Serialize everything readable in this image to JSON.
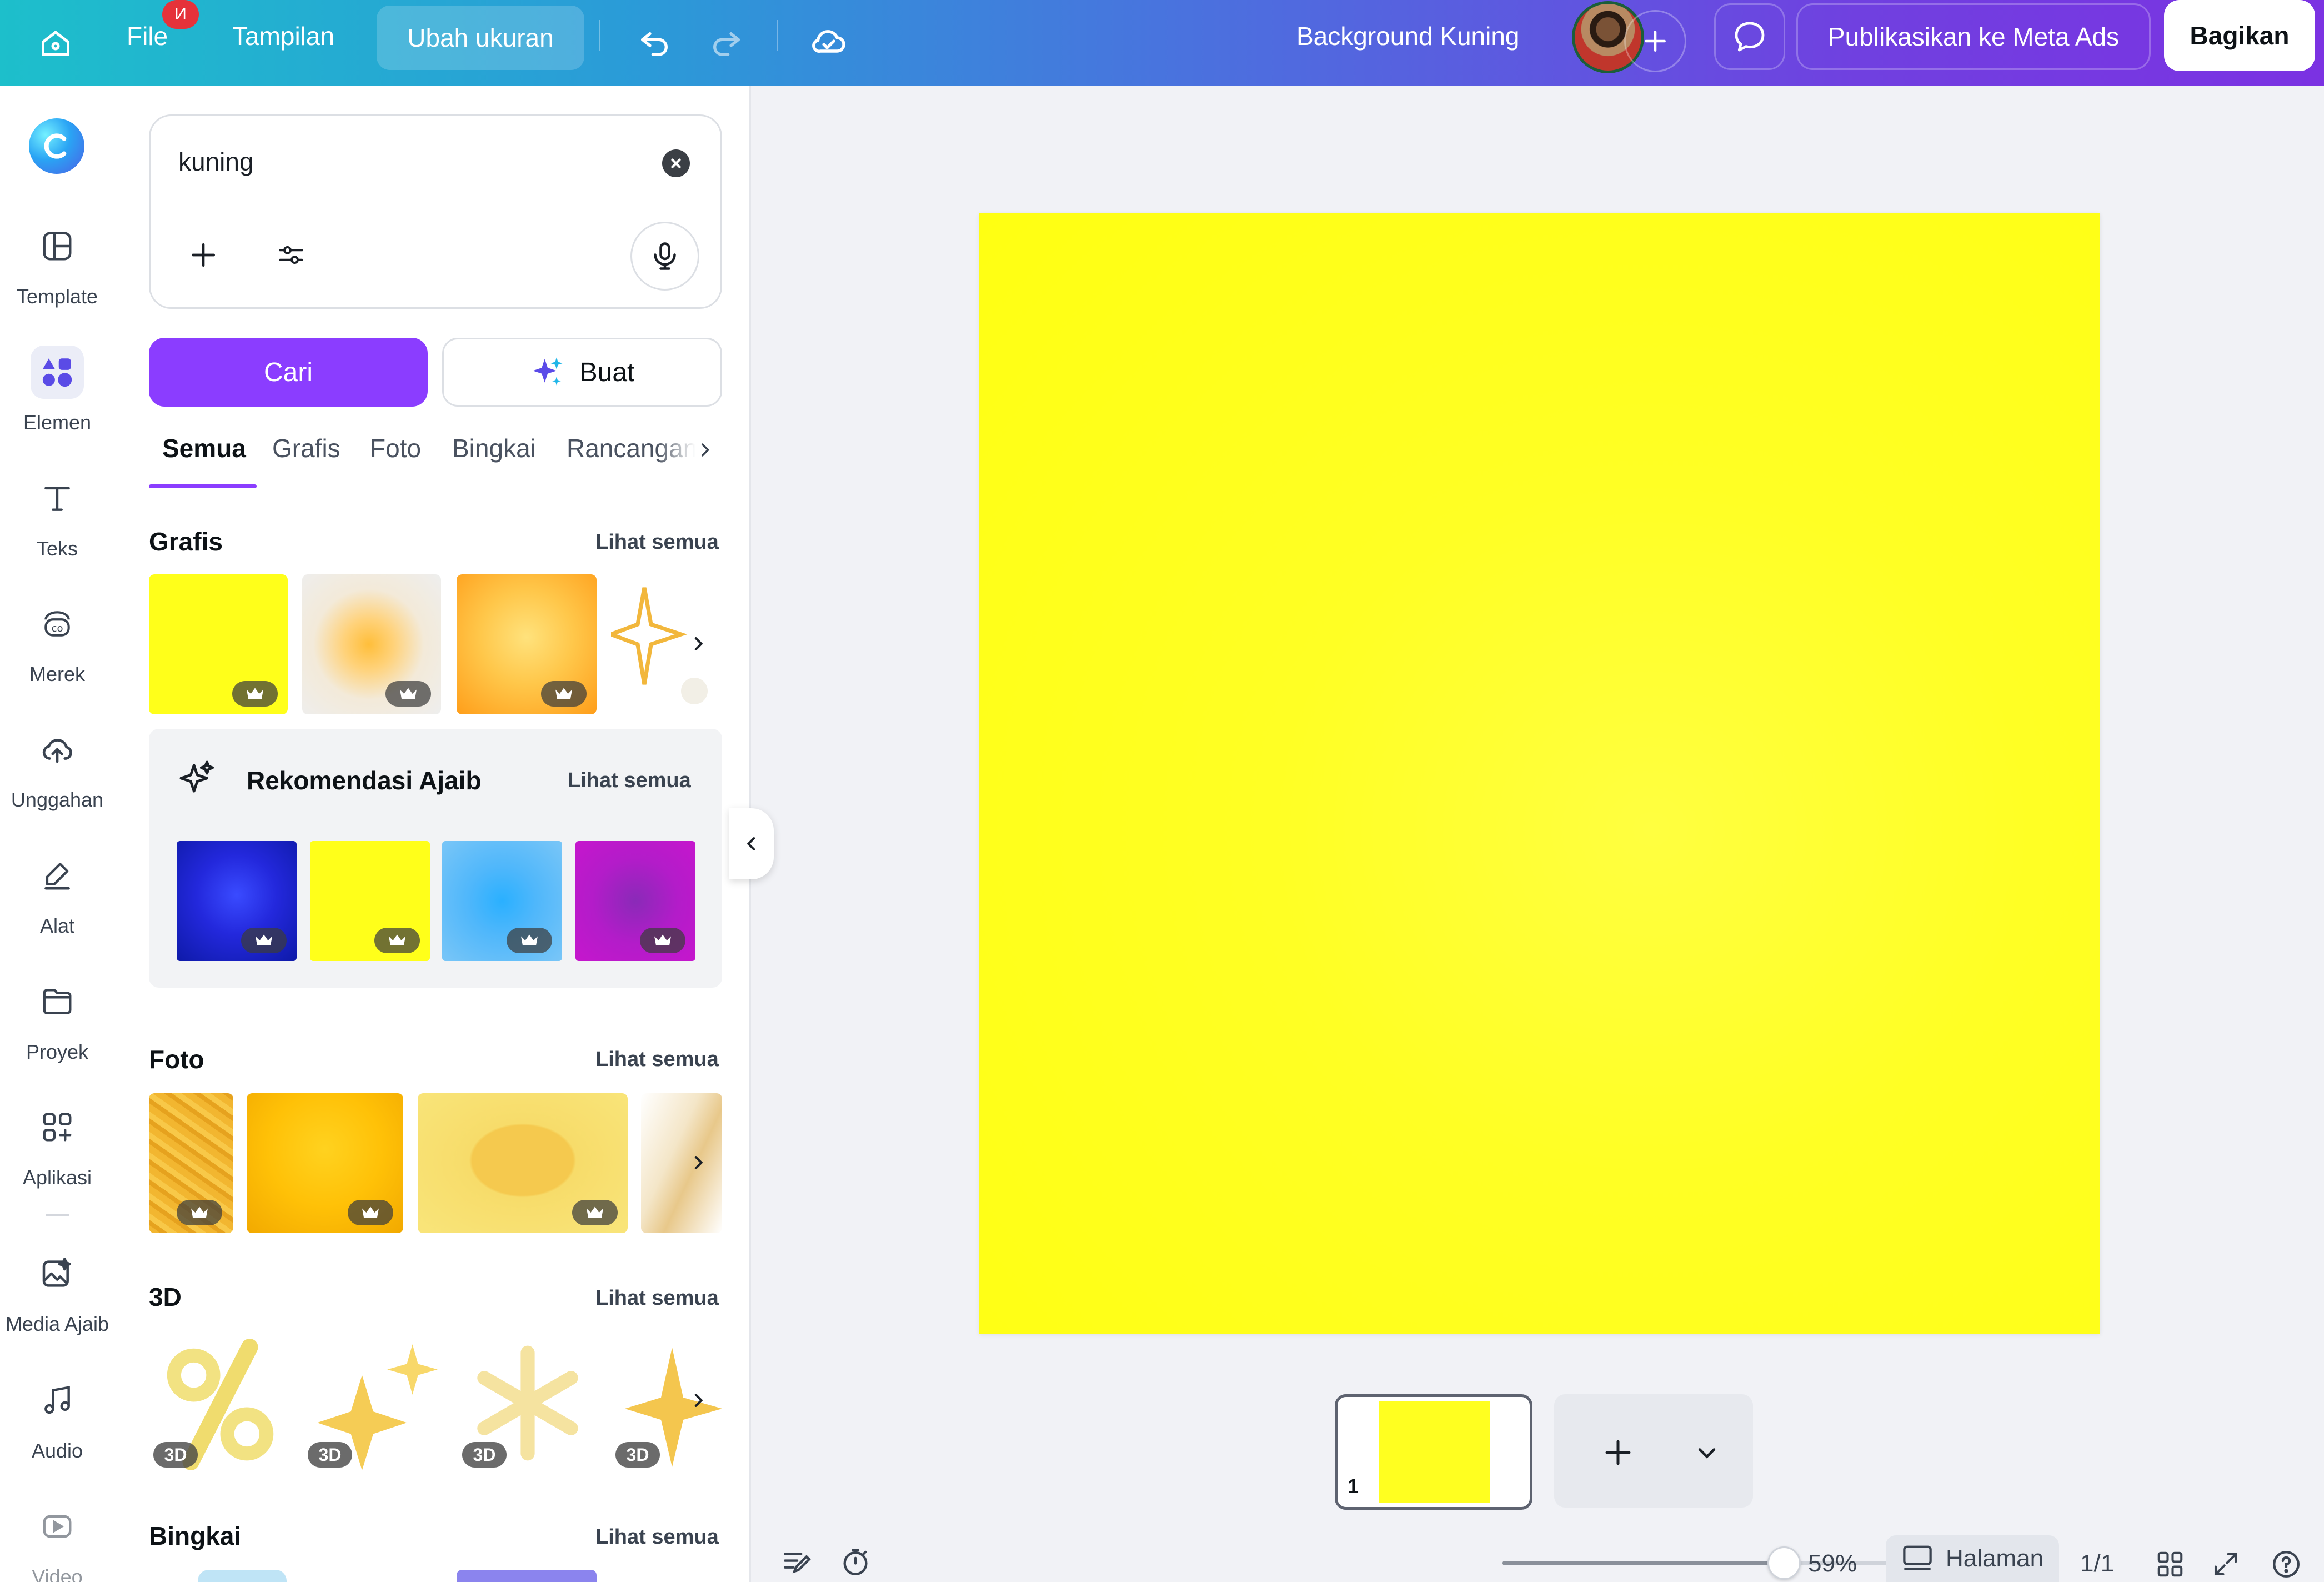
{
  "topbar": {
    "file_label": "File",
    "file_badge": "И",
    "view_label": "Tampilan",
    "resize_label": "Ubah ukuran",
    "doc_title": "Background Kuning",
    "publish_label": "Publikasikan ke Meta Ads",
    "share_label": "Bagikan"
  },
  "rail": {
    "items": [
      {
        "label": "Template"
      },
      {
        "label": "Elemen"
      },
      {
        "label": "Teks"
      },
      {
        "label": "Merek"
      },
      {
        "label": "Unggahan"
      },
      {
        "label": "Alat"
      },
      {
        "label": "Proyek"
      },
      {
        "label": "Aplikasi"
      },
      {
        "label": "Media Ajaib"
      },
      {
        "label": "Audio"
      },
      {
        "label": "Video"
      }
    ]
  },
  "panel": {
    "search_value": "kuning",
    "search_button": "Cari",
    "generate_button": "Buat",
    "tabs": [
      "Semua",
      "Grafis",
      "Foto",
      "Bingkai",
      "Rancangan"
    ],
    "see_all": "Lihat semua",
    "sections": {
      "grafis": "Grafis",
      "rekomendasi": "Rekomendasi Ajaib",
      "foto": "Foto",
      "threed": "3D",
      "bingkai": "Bingkai"
    },
    "badge_3d": "3D"
  },
  "canvas": {
    "page_color": "#ffff1a",
    "page_number": "1"
  },
  "bottombar": {
    "zoom": "59%",
    "zoom_level": 0.59,
    "pages_label": "Halaman",
    "page_count": "1/1"
  },
  "colors": {
    "accent": "#8b3dff",
    "canvas_yellow": "#ffff1a"
  }
}
